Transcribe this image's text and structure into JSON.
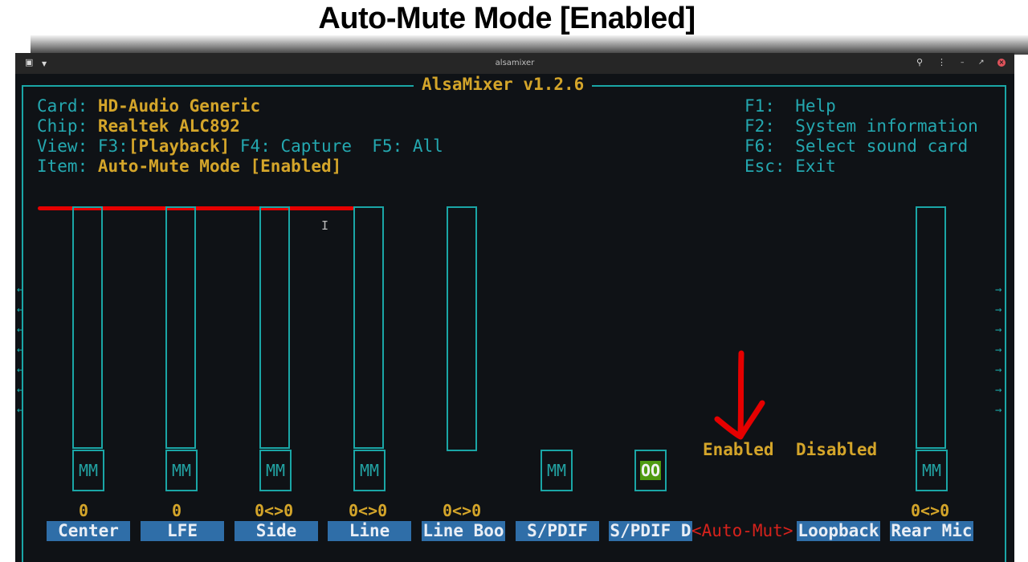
{
  "heading": "Auto-Mute Mode [Enabled]",
  "window": {
    "title": "alsamixer",
    "icons": [
      "terminal-icon",
      "chevron-down-icon",
      "search-icon",
      "menu-icon",
      "minimize-icon",
      "maximize-icon",
      "close-icon"
    ]
  },
  "frame_title": "AlsaMixer v1.2.6",
  "info": {
    "card_label": "Card:",
    "card_value": "HD-Audio Generic",
    "chip_label": "Chip:",
    "chip_value": "Realtek ALC892",
    "view_label": "View:",
    "view_f3": "F3:",
    "view_playback": "[Playback]",
    "view_f4": "F4: Capture",
    "view_f5": "F5: All",
    "item_label": "Item:",
    "item_value": "Auto-Mute Mode [Enabled]"
  },
  "help": {
    "f1_key": "F1:",
    "f1_text": "Help",
    "f2_key": "F2:",
    "f2_text": "System information",
    "f6_key": "F6:",
    "f6_text": "Select sound card",
    "esc_key": "Esc:",
    "esc_text": "Exit"
  },
  "controls": [
    {
      "name": "Center",
      "value": "0",
      "mute": "MM"
    },
    {
      "name": "LFE",
      "value": "0",
      "mute": "MM"
    },
    {
      "name": "Side",
      "value": "0<>0",
      "mute": "MM"
    },
    {
      "name": "Line",
      "value": "0<>0",
      "mute": "MM"
    },
    {
      "name": "Line Boo",
      "value": "0<>0"
    },
    {
      "name": "S/PDIF",
      "mute": "MM"
    },
    {
      "name": "S/PDIF D",
      "mute": "OO"
    },
    {
      "name": "Auto-Mut",
      "prefix": "<",
      "suffix": ">",
      "options": [
        "Enabled",
        "Disabled"
      ]
    },
    {
      "name": "Loopback"
    },
    {
      "name": "Rear Mic",
      "value": "0<>0",
      "mute": "MM"
    }
  ],
  "colors": {
    "cyan": "#1aa6a6",
    "yellow": "#d4a52a",
    "label_bg": "#2f6ea8",
    "highlight": "#e60000",
    "oo_bg": "#4f9a10"
  }
}
